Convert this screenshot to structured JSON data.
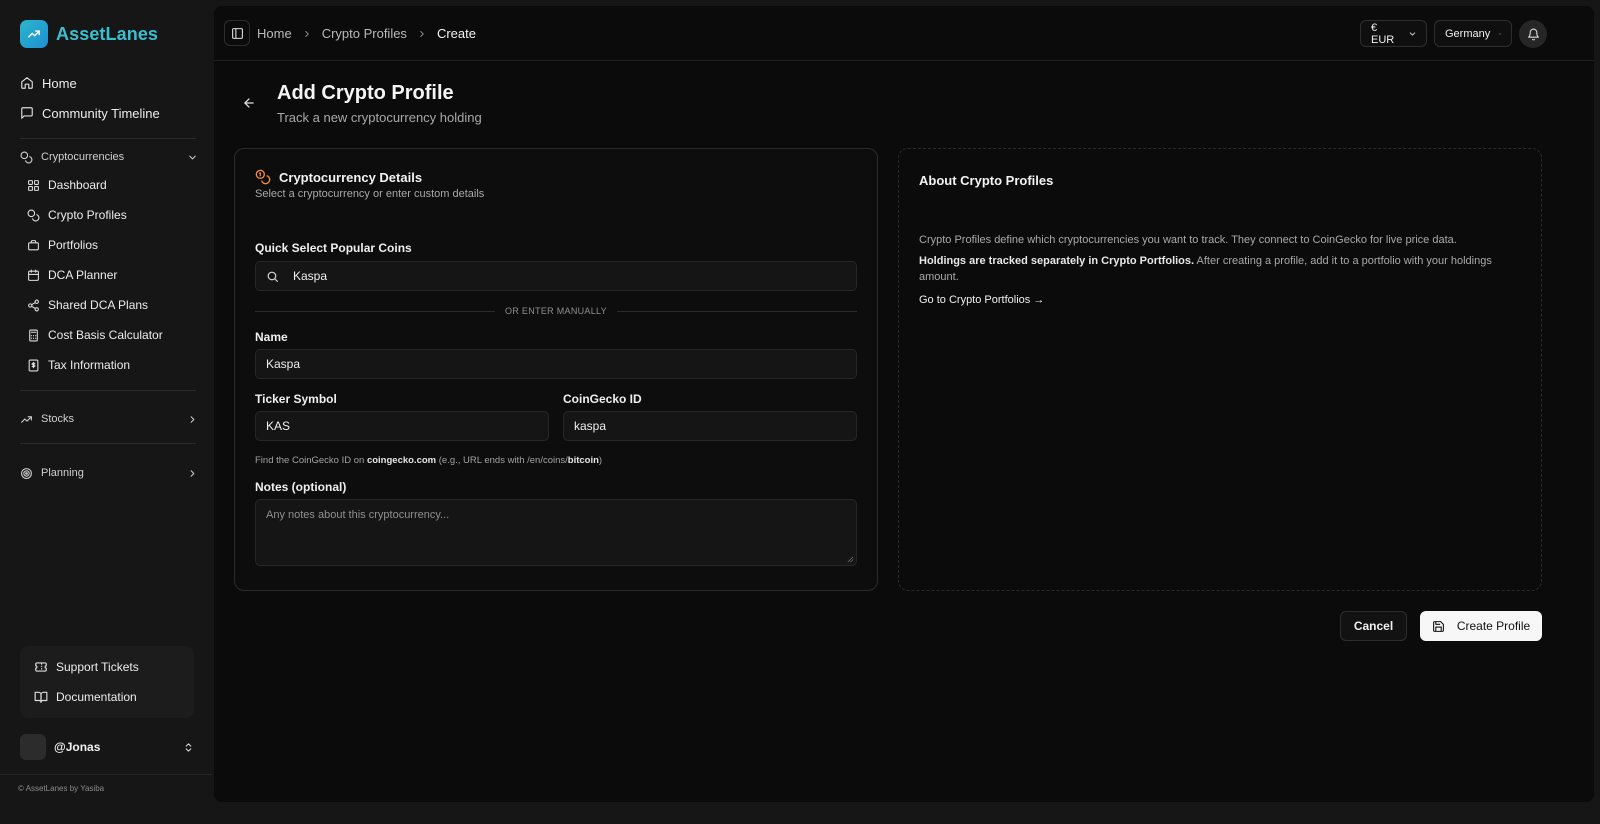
{
  "brand": {
    "name": "AssetLanes"
  },
  "nav": {
    "home": "Home",
    "community": "Community Timeline",
    "crypto_section": "Cryptocurrencies",
    "crypto_items": [
      "Dashboard",
      "Crypto Profiles",
      "Portfolios",
      "DCA Planner",
      "Shared DCA Plans",
      "Cost Basis Calculator",
      "Tax Information"
    ],
    "stocks_section": "Stocks",
    "planning_section": "Planning",
    "support": "Support Tickets",
    "docs": "Documentation"
  },
  "user": {
    "name": "@Jonas"
  },
  "footer": {
    "text": "© AssetLanes by Yasiba"
  },
  "breadcrumbs": [
    "Home",
    "Crypto Profiles",
    "Create"
  ],
  "topbar": {
    "currency": "€ EUR",
    "country": "Germany"
  },
  "page": {
    "title": "Add Crypto Profile",
    "subtitle": "Track a new cryptocurrency holding"
  },
  "form": {
    "title": "Cryptocurrency Details",
    "description": "Select a cryptocurrency or enter custom details",
    "quick_label": "Quick Select Popular Coins",
    "quick_value": "Kaspa",
    "or_text": "OR ENTER MANUALLY",
    "name_label": "Name",
    "name_value": "Kaspa",
    "ticker_label": "Ticker Symbol",
    "ticker_value": "KAS",
    "cg_label": "CoinGecko ID",
    "cg_value": "kaspa",
    "hint_prefix": "Find the CoinGecko ID on",
    "hint_site": "coingecko.com",
    "hint_middle": "(e.g., URL ends with /en/coins/",
    "hint_example": "bitcoin",
    "hint_suffix": ")",
    "notes_label": "Notes (optional)",
    "notes_placeholder": "Any notes about this cryptocurrency..."
  },
  "about": {
    "title": "About Crypto Profiles",
    "p1": "Crypto Profiles define which cryptocurrencies you want to track. They connect to CoinGecko for live price data.",
    "p2_bold": "Holdings are tracked separately in Crypto Portfolios.",
    "p2_rest": " After creating a profile, add it to a portfolio with your holdings amount.",
    "link": "Go to Crypto Portfolios →"
  },
  "actions": {
    "cancel": "Cancel",
    "create": "Create Profile"
  },
  "colors": {
    "accent": "#3bbfcf",
    "warning_icon": "#f08a3c",
    "background": "#0b0b0b"
  },
  "icons": [
    "trend-icon",
    "home-icon",
    "message-icon",
    "coins-icon",
    "chevron-down-icon",
    "grid-icon",
    "briefcase-icon",
    "calendar-icon",
    "share-icon",
    "calculator-icon",
    "receipt-icon",
    "chevron-right-icon",
    "target-icon",
    "ticket-icon",
    "book-icon",
    "chevrons-updown-icon",
    "sidebar-toggle-icon",
    "bell-icon",
    "arrow-left-icon",
    "search-icon",
    "save-icon"
  ]
}
